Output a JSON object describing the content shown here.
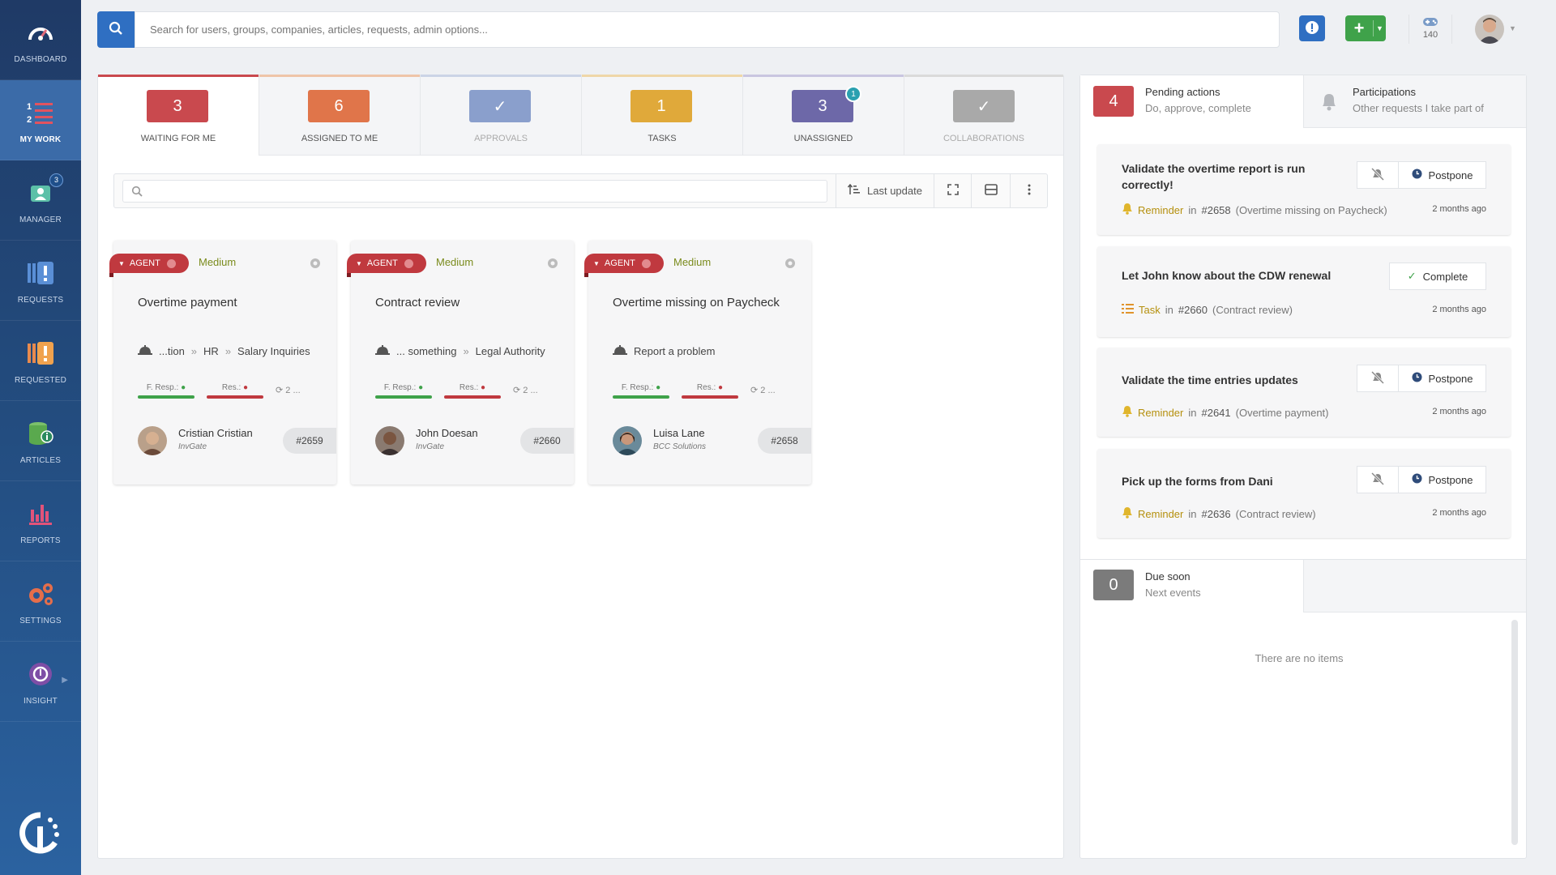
{
  "sidebar": {
    "items": [
      {
        "label": "DASHBOARD",
        "icon": "dashboard-gauge-icon"
      },
      {
        "label": "MY WORK",
        "icon": "my-work-list-icon",
        "active": true
      },
      {
        "label": "MANAGER",
        "icon": "manager-people-icon",
        "badge": "3"
      },
      {
        "label": "REQUESTS",
        "icon": "requests-icon"
      },
      {
        "label": "REQUESTED",
        "icon": "requested-icon"
      },
      {
        "label": "ARTICLES",
        "icon": "articles-database-icon"
      },
      {
        "label": "REPORTS",
        "icon": "reports-bar-chart-icon"
      },
      {
        "label": "SETTINGS",
        "icon": "settings-gears-icon"
      },
      {
        "label": "INSIGHT",
        "icon": "insight-icon"
      }
    ]
  },
  "search": {
    "placeholder": "Search for users, groups, companies, articles, requests, admin options..."
  },
  "header": {
    "credits": "140"
  },
  "tabs": [
    {
      "count": "3",
      "label": "WAITING FOR ME",
      "color": "#c9494e"
    },
    {
      "count": "6",
      "label": "ASSIGNED TO ME",
      "color": "#e0754a"
    },
    {
      "count": "✓",
      "label": "APPROVALS",
      "color": "#8a9fcc"
    },
    {
      "count": "1",
      "label": "TASKS",
      "color": "#e0a93a"
    },
    {
      "count": "3",
      "label": "UNASSIGNED",
      "color": "#6d68a8",
      "badge": "1"
    },
    {
      "count": "✓",
      "label": "COLLABORATIONS",
      "color": "#a9a9a9"
    }
  ],
  "toolbar": {
    "sort_label": "Last update"
  },
  "cards": [
    {
      "tag": "AGENT",
      "priority": "Medium",
      "title": "Overtime payment",
      "crumbs": [
        "...tion",
        "HR",
        "Salary Inquiries"
      ],
      "sla1": "F. Resp.:",
      "sla2": "Res.:",
      "count": "2 ...",
      "person": "Cristian Cristian",
      "company": "InvGate",
      "id": "#2659"
    },
    {
      "tag": "AGENT",
      "priority": "Medium",
      "title": "Contract review",
      "crumbs": [
        "... something",
        "Legal Authority"
      ],
      "sla1": "F. Resp.:",
      "sla2": "Res.:",
      "count": "2 ...",
      "person": "John Doesan",
      "company": "InvGate",
      "id": "#2660"
    },
    {
      "tag": "AGENT",
      "priority": "Medium",
      "title": "Overtime missing on Paycheck",
      "crumbs": [
        "Report a problem"
      ],
      "sla1": "F. Resp.:",
      "sla2": "Res.:",
      "count": "2 ...",
      "person": "Luisa Lane",
      "company": "BCC Solutions",
      "id": "#2658"
    }
  ],
  "side": {
    "pending": {
      "count": "4",
      "title": "Pending actions",
      "subtitle": "Do, approve, complete"
    },
    "participations": {
      "title": "Participations",
      "subtitle": "Other requests I take part of"
    },
    "actions": [
      {
        "title": "Validate the overtime report is run correctly!",
        "button": "Postpone",
        "kind": "Reminder",
        "ref": "#2658",
        "context": "(Overtime missing on Paycheck)",
        "time": "2 months ago"
      },
      {
        "title": "Let John know about the CDW renewal",
        "button": "Complete",
        "kind": "Task",
        "ref": "#2660",
        "context": "(Contract review)",
        "time": "2 months ago"
      },
      {
        "title": "Validate the time entries updates",
        "button": "Postpone",
        "kind": "Reminder",
        "ref": "#2641",
        "context": "(Overtime payment)",
        "time": "2 months ago"
      },
      {
        "title": "Pick up the forms from Dani",
        "button": "Postpone",
        "kind": "Reminder",
        "ref": "#2636",
        "context": "(Contract review)",
        "time": "2 months ago"
      }
    ],
    "in_word": "in",
    "due": {
      "count": "0",
      "title": "Due soon",
      "subtitle": "Next events",
      "empty": "There are no items"
    }
  },
  "colors": {
    "sidebar": "#234d80",
    "primary": "#2f6fc2",
    "success": "#3fa24a",
    "danger": "#c0393f",
    "reminder": "#b5900e"
  }
}
